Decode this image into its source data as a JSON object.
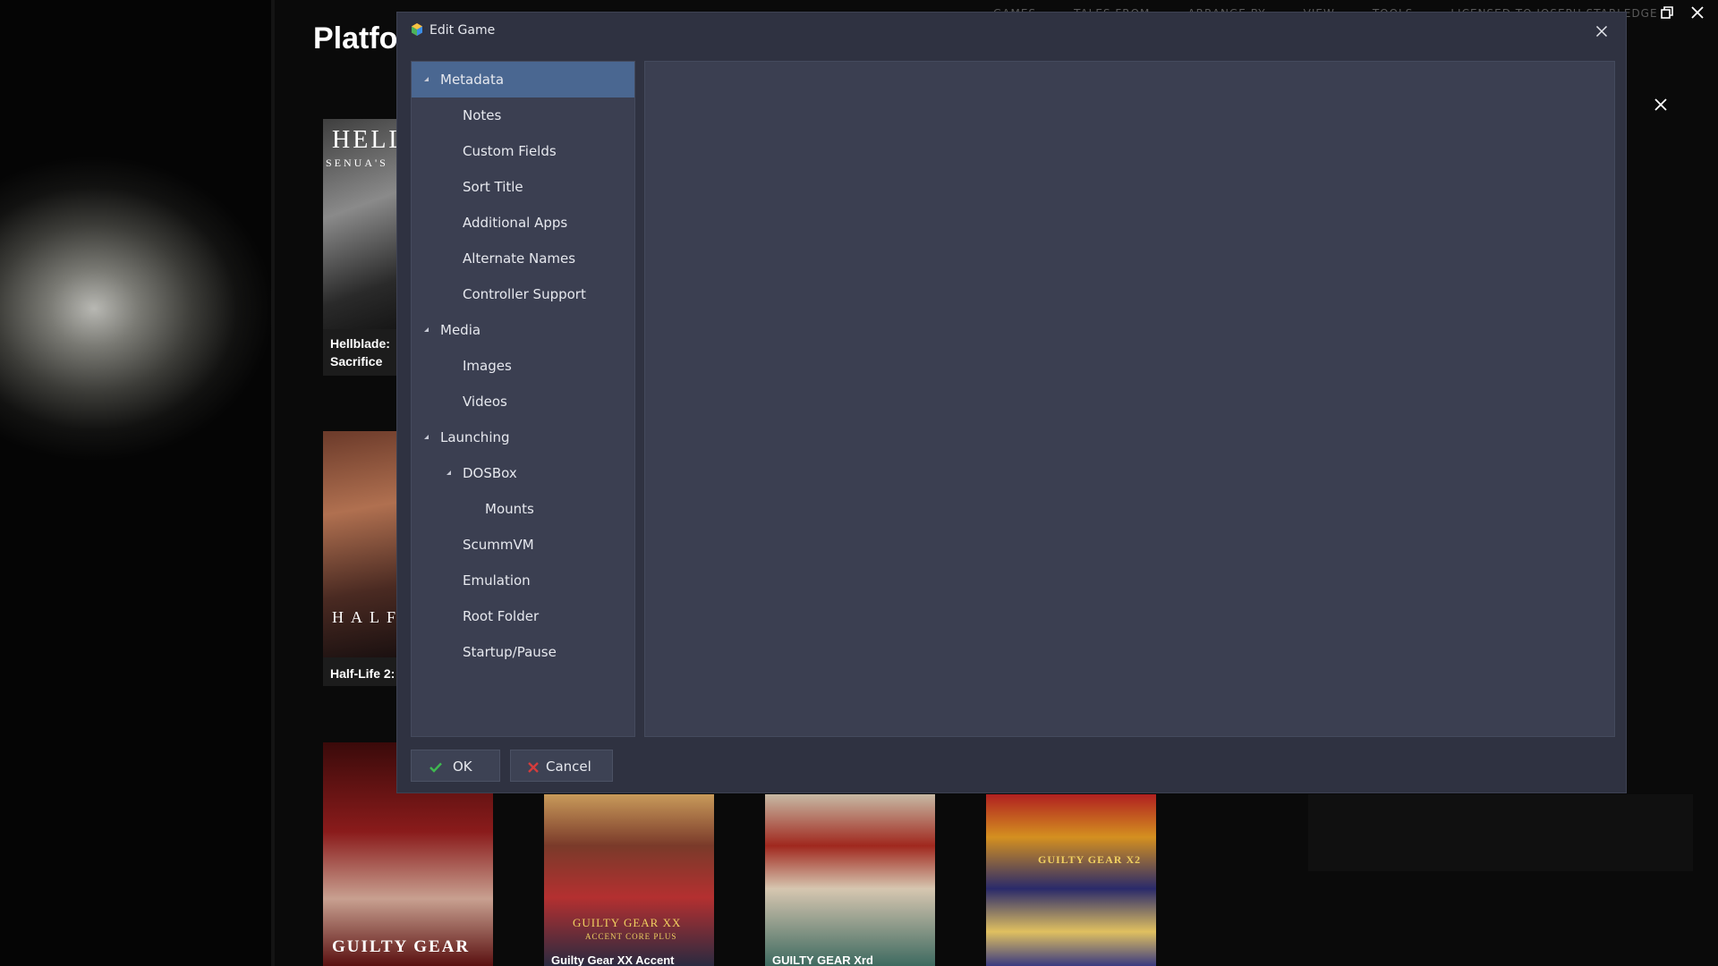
{
  "background": {
    "page_title": "Platfo",
    "menu_items": [
      "GAMES",
      "TALES FROM",
      "ARRANGE BY",
      "VIEW",
      "TOOLS",
      "LICENSED TO JOSEPH STARLEDGE"
    ],
    "tiles": [
      {
        "caption_line1": "Hellblade:",
        "caption_line2": "Sacrifice",
        "logo_line1": "HELL",
        "logo_line2": "SENUA'S"
      },
      {
        "caption_line1": "Half-Life 2:",
        "logo_line1": "HALF"
      },
      {
        "logo_line1": "GUILTY GEAR"
      },
      {
        "logo_line1": "GUILTY GEAR XX",
        "logo_line2": "ACCENT CORE PLUS",
        "caption_line1": "Guilty Gear XX Accent"
      },
      {
        "caption_line1": "GUILTY GEAR Xrd"
      },
      {
        "logo_line1": "GUILTY GEAR X2"
      }
    ]
  },
  "dialog": {
    "title": "Edit Game",
    "tree": [
      {
        "label": "Metadata",
        "level": 0,
        "expanded": true,
        "selected": true
      },
      {
        "label": "Notes",
        "level": 1
      },
      {
        "label": "Custom Fields",
        "level": 1
      },
      {
        "label": "Sort Title",
        "level": 1
      },
      {
        "label": "Additional Apps",
        "level": 1
      },
      {
        "label": "Alternate Names",
        "level": 1
      },
      {
        "label": "Controller Support",
        "level": 1
      },
      {
        "label": "Media",
        "level": 0,
        "expanded": true
      },
      {
        "label": "Images",
        "level": 1
      },
      {
        "label": "Videos",
        "level": 1
      },
      {
        "label": "Launching",
        "level": 0,
        "expanded": true
      },
      {
        "label": "DOSBox",
        "level": 1,
        "expanded": true
      },
      {
        "label": "Mounts",
        "level": 2
      },
      {
        "label": "ScummVM",
        "level": 1
      },
      {
        "label": "Emulation",
        "level": 1
      },
      {
        "label": "Root Folder",
        "level": 1
      },
      {
        "label": "Startup/Pause",
        "level": 1
      }
    ],
    "buttons": {
      "ok_label": "OK",
      "cancel_label": "Cancel"
    }
  },
  "colors": {
    "dialog_bg": "#2f3241",
    "panel_bg": "#3b3f51",
    "selection": "#4a6791",
    "ok_check": "#3fb950",
    "cancel_x": "#d43c3c"
  }
}
